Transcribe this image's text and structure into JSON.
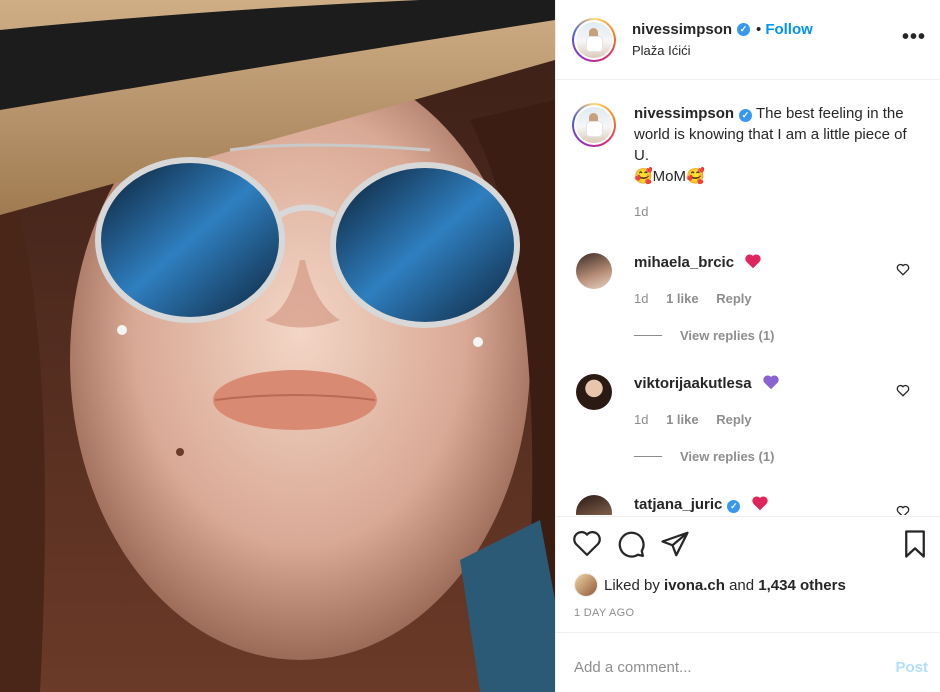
{
  "header": {
    "username": "nivessimpson",
    "separator": "•",
    "follow_label": "Follow",
    "location": "Plaža Ićići",
    "more_label": "•••"
  },
  "caption": {
    "username": "nivessimpson",
    "text": "The best feeling in the world is knowing that I am a little piece of U.",
    "line2": "🥰MoM🥰",
    "age": "1d"
  },
  "comments": [
    {
      "username": "mihaela_brcic",
      "emoji": "red-heart",
      "age": "1d",
      "likes": "1 like",
      "reply": "Reply",
      "view_replies": "View replies (1)"
    },
    {
      "username": "viktorijaakutlesa",
      "emoji": "purple-heart",
      "age": "1d",
      "likes": "1 like",
      "reply": "Reply",
      "view_replies": "View replies (1)"
    },
    {
      "username": "tatjana_juric",
      "emoji": "red-heart"
    }
  ],
  "actions": {
    "liked_by_prefix": "Liked by",
    "liked_by_user": "ivona.ch",
    "and": "and",
    "others": "1,434 others",
    "time_ago": "1 DAY AGO"
  },
  "comment_box": {
    "placeholder": "Add a comment...",
    "post_label": "Post"
  },
  "colors": {
    "accent": "#0095f6",
    "verified": "#3897f0",
    "muted": "#8e8e8e",
    "heart_red": "#ed4956",
    "heart_purple": "#8a63d2"
  }
}
